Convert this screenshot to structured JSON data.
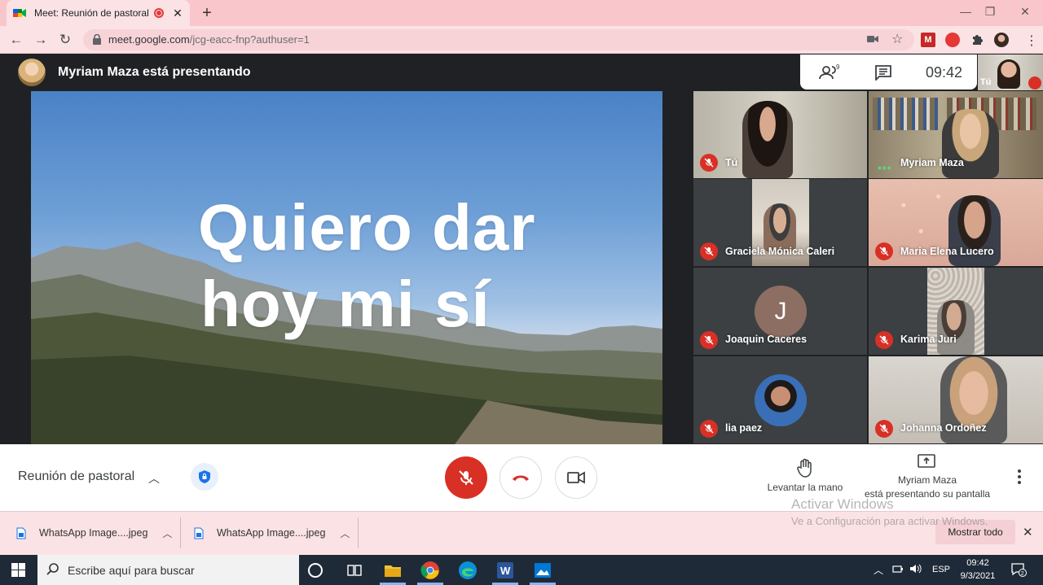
{
  "browser": {
    "tab_title": "Meet: Reunión de pastoral",
    "tab_close": "✕",
    "new_tab": "+",
    "url_host": "meet.google.com",
    "url_path": "/jcg-eacc-fnp?authuser=1",
    "window_min": "—",
    "window_max": "❐",
    "window_close": "✕"
  },
  "meet": {
    "presenter_title": "Myriam Maza está presentando",
    "people_count": "9",
    "clock": "09:42",
    "self_label": "Tú",
    "slide": {
      "line1": "Quiero dar",
      "line2": "hoy mi sí"
    },
    "participants": [
      {
        "name": "Tú"
      },
      {
        "name": "Myriam Maza"
      },
      {
        "name": "Graciela Mónica Caleri"
      },
      {
        "name": "Maria Elena Lucero"
      },
      {
        "name": "Joaquin Caceres",
        "initial": "J"
      },
      {
        "name": "Karima Juri"
      },
      {
        "name": "lia paez"
      },
      {
        "name": "Johanna Ordoñez"
      }
    ],
    "meeting_name": "Reunión de pastoral",
    "raise_hand": "Levantar la mano",
    "presenting_name": "Myriam Maza",
    "presenting_text": "está presentando su pantalla",
    "colors": {
      "mic_off_red": "#d93025",
      "dark_bg": "#202124"
    }
  },
  "watermark": {
    "line1": "Activar Windows",
    "line2": "Ve a Configuración para activar Windows."
  },
  "downloads": {
    "items": [
      {
        "name": "WhatsApp Image....jpeg"
      },
      {
        "name": "WhatsApp Image....jpeg"
      }
    ],
    "show_all": "Mostrar todo",
    "close": "✕"
  },
  "taskbar": {
    "search_placeholder": "Escribe aquí para buscar",
    "lang": "ESP",
    "time": "09:42",
    "date": "9/3/2021",
    "notifications": "2"
  }
}
